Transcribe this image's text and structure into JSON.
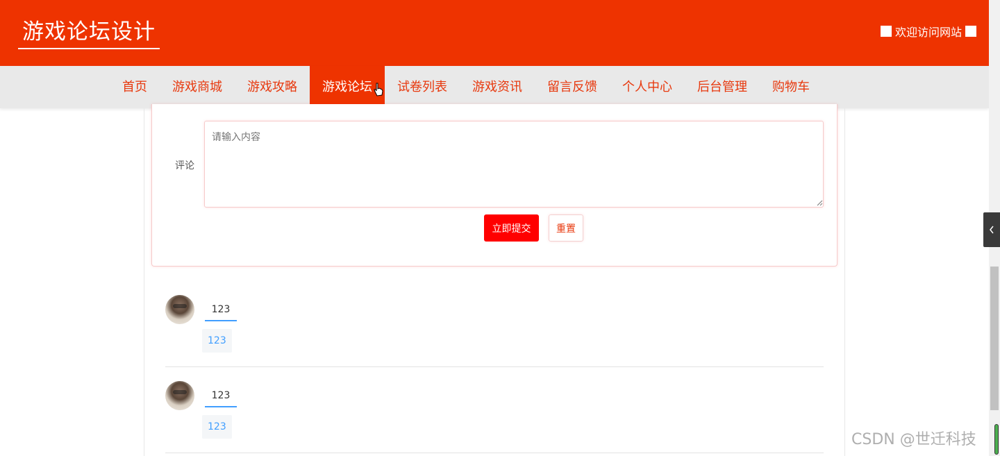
{
  "header": {
    "site_title": "游戏论坛设计",
    "welcome_text": "欢迎访问网站"
  },
  "nav": {
    "items": [
      {
        "label": "首页",
        "active": false
      },
      {
        "label": "游戏商城",
        "active": false
      },
      {
        "label": "游戏攻略",
        "active": false
      },
      {
        "label": "游戏论坛",
        "active": true
      },
      {
        "label": "试卷列表",
        "active": false
      },
      {
        "label": "游戏资讯",
        "active": false
      },
      {
        "label": "留言反馈",
        "active": false
      },
      {
        "label": "个人中心",
        "active": false
      },
      {
        "label": "后台管理",
        "active": false
      },
      {
        "label": "购物车",
        "active": false
      }
    ]
  },
  "form": {
    "comment_label": "评论",
    "comment_placeholder": "请输入内容",
    "submit_label": "立即提交",
    "reset_label": "重置"
  },
  "comments": [
    {
      "user": "123",
      "text": "123"
    },
    {
      "user": "123",
      "text": "123"
    }
  ],
  "side_tab_icon": "chevron-left-icon",
  "watermark": "CSDN @世迁科技",
  "colors": {
    "brand": "#ee3300",
    "nav_bg": "#e9e9e9",
    "nav_text": "#e8380d",
    "submit_bg": "#ff0000",
    "link_blue": "#409eff"
  }
}
